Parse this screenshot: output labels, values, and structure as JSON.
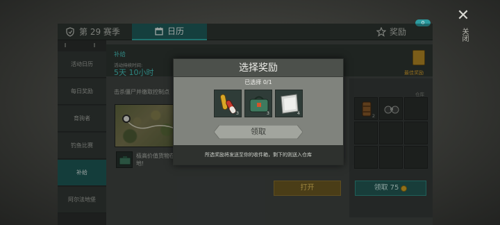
{
  "header": {
    "season": "第 29 赛季",
    "calendar_tab": "日历",
    "rewards_tab": "奖励",
    "notification": "0",
    "close_label": "关闭"
  },
  "sidebar": {
    "items": [
      {
        "label": "活动日历"
      },
      {
        "label": "每日奖励"
      },
      {
        "label": "育驹者"
      },
      {
        "label": "钓鱼比赛"
      },
      {
        "label": "补给"
      },
      {
        "label": "阿尔法地堡"
      }
    ]
  },
  "event": {
    "title": "补给",
    "duration_label": "活动持续时间:",
    "duration_value": "5天 10小时",
    "best_reward_label": "最佳奖励",
    "task": "击杀僵尸并缴取控制点",
    "item_description": "极高价值货物在地!"
  },
  "storage": {
    "label": "仓库",
    "cells": [
      {
        "icon": "fuel-barrel-icon",
        "qty": "2"
      },
      {
        "icon": "binoculars-icon",
        "qty": ""
      }
    ]
  },
  "buttons": {
    "open": "打开",
    "claim": "领取",
    "claim_cost": "75"
  },
  "modal": {
    "title": "选择奖励",
    "selected": "已选择 0/1",
    "rewards": [
      {
        "icon": "pills-icon",
        "qty": "3"
      },
      {
        "icon": "supply-bag-icon",
        "qty": "3"
      },
      {
        "icon": "sheet-metal-icon",
        "qty": "4"
      }
    ],
    "get_button": "领取",
    "footer": "所选奖励将发送至你的收件箱，剩下的则送入仓库"
  },
  "colors": {
    "accent_teal": "#46c6bf",
    "gold": "#d6a12c",
    "active_tab": "#1f5e5c"
  }
}
